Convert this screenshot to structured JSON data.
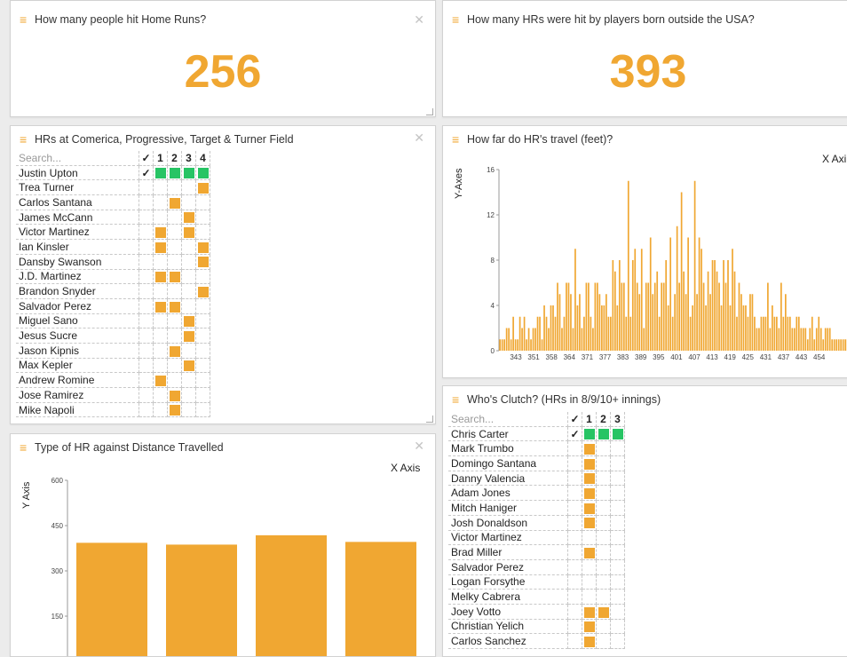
{
  "accent": "#f0a732",
  "green": "#27c464",
  "p1": {
    "title": "How many people hit Home Runs?",
    "value": "256"
  },
  "p2": {
    "title": "How many HRs were hit by players born outside the USA?",
    "value": "393"
  },
  "p3": {
    "title": "HRs at Comerica, Progressive, Target & Turner Field",
    "search": "Search...",
    "cols": [
      "✓",
      "1",
      "2",
      "3",
      "4"
    ],
    "rows": [
      {
        "name": "Justin Upton",
        "check": true,
        "cells": [
          "g",
          "g",
          "g",
          "g"
        ]
      },
      {
        "name": "Trea Turner",
        "check": false,
        "cells": [
          "",
          "",
          "",
          "o"
        ]
      },
      {
        "name": "Carlos Santana",
        "check": false,
        "cells": [
          "",
          "o",
          "",
          ""
        ]
      },
      {
        "name": "James McCann",
        "check": false,
        "cells": [
          "",
          "",
          "o",
          ""
        ]
      },
      {
        "name": "Victor Martinez",
        "check": false,
        "cells": [
          "o",
          "",
          "o",
          ""
        ]
      },
      {
        "name": "Ian Kinsler",
        "check": false,
        "cells": [
          "o",
          "",
          "",
          "o"
        ]
      },
      {
        "name": "Dansby Swanson",
        "check": false,
        "cells": [
          "",
          "",
          "",
          "o"
        ]
      },
      {
        "name": "J.D. Martinez",
        "check": false,
        "cells": [
          "o",
          "o",
          "",
          ""
        ]
      },
      {
        "name": "Brandon Snyder",
        "check": false,
        "cells": [
          "",
          "",
          "",
          "o"
        ]
      },
      {
        "name": "Salvador Perez",
        "check": false,
        "cells": [
          "o",
          "o",
          "",
          ""
        ]
      },
      {
        "name": "Miguel Sano",
        "check": false,
        "cells": [
          "",
          "",
          "o",
          ""
        ]
      },
      {
        "name": "Jesus Sucre",
        "check": false,
        "cells": [
          "",
          "",
          "o",
          ""
        ]
      },
      {
        "name": "Jason Kipnis",
        "check": false,
        "cells": [
          "",
          "o",
          "",
          ""
        ]
      },
      {
        "name": "Max Kepler",
        "check": false,
        "cells": [
          "",
          "",
          "o",
          ""
        ]
      },
      {
        "name": "Andrew Romine",
        "check": false,
        "cells": [
          "o",
          "",
          "",
          ""
        ]
      },
      {
        "name": "Jose Ramirez",
        "check": false,
        "cells": [
          "",
          "o",
          "",
          ""
        ]
      },
      {
        "name": "Mike Napoli",
        "check": false,
        "cells": [
          "",
          "o",
          "",
          ""
        ]
      }
    ]
  },
  "p4": {
    "title": "How far do HR's travel (feet)?",
    "xlabel": "X Axi",
    "ylabel": "Y-Axes",
    "chart_data": {
      "type": "bar",
      "ylim": [
        0,
        16
      ],
      "yticks": [
        0,
        4,
        8,
        12,
        16
      ],
      "xticks": [
        "343",
        "351",
        "358",
        "364",
        "371",
        "377",
        "383",
        "389",
        "395",
        "401",
        "407",
        "413",
        "419",
        "425",
        "431",
        "437",
        "443",
        "454"
      ],
      "values": [
        1,
        1,
        1,
        2,
        2,
        1,
        3,
        1,
        1,
        3,
        2,
        3,
        1,
        2,
        1,
        2,
        2,
        3,
        3,
        1,
        4,
        3,
        2,
        4,
        4,
        3,
        6,
        5,
        2,
        3,
        6,
        6,
        5,
        2,
        9,
        4,
        5,
        2,
        3,
        6,
        6,
        3,
        2,
        6,
        6,
        5,
        4,
        4,
        5,
        3,
        3,
        8,
        7,
        4,
        8,
        6,
        6,
        3,
        15,
        3,
        8,
        9,
        6,
        5,
        9,
        2,
        6,
        6,
        10,
        5,
        6,
        7,
        3,
        6,
        6,
        8,
        4,
        10,
        3,
        5,
        11,
        6,
        14,
        7,
        5,
        10,
        3,
        4,
        15,
        5,
        10,
        9,
        6,
        4,
        7,
        5,
        8,
        8,
        7,
        6,
        4,
        8,
        6,
        8,
        4,
        9,
        7,
        3,
        6,
        5,
        4,
        4,
        3,
        5,
        5,
        3,
        2,
        2,
        3,
        3,
        3,
        6,
        2,
        4,
        3,
        3,
        2,
        6,
        3,
        5,
        3,
        3,
        2,
        2,
        3,
        3,
        2,
        2,
        2,
        1,
        2,
        3,
        1,
        2,
        3,
        2,
        1,
        2,
        2,
        2,
        1,
        1,
        1,
        1,
        1,
        1,
        1,
        1,
        1,
        1
      ]
    }
  },
  "p5": {
    "title": "Type of HR against Distance Travelled",
    "xlabel": "X Axis",
    "ylabel": "Y Axis",
    "chart_data": {
      "type": "bar",
      "ylim": [
        0,
        600
      ],
      "yticks": [
        150,
        300,
        450,
        600
      ],
      "values": [
        393,
        387,
        418,
        396
      ]
    }
  },
  "p6": {
    "title": "Who's Clutch? (HRs in 8/9/10+ innings)",
    "search": "Search...",
    "cols": [
      "✓",
      "1",
      "2",
      "3"
    ],
    "rows": [
      {
        "name": "Chris Carter",
        "check": true,
        "cells": [
          "g",
          "g",
          "g"
        ]
      },
      {
        "name": "Mark Trumbo",
        "check": false,
        "cells": [
          "o",
          "",
          ""
        ]
      },
      {
        "name": "Domingo Santana",
        "check": false,
        "cells": [
          "o",
          "",
          ""
        ]
      },
      {
        "name": "Danny Valencia",
        "check": false,
        "cells": [
          "o",
          "",
          ""
        ]
      },
      {
        "name": "Adam Jones",
        "check": false,
        "cells": [
          "o",
          "",
          ""
        ]
      },
      {
        "name": "Mitch Haniger",
        "check": false,
        "cells": [
          "o",
          "",
          ""
        ]
      },
      {
        "name": "Josh Donaldson",
        "check": false,
        "cells": [
          "o",
          "",
          ""
        ]
      },
      {
        "name": "Victor Martinez",
        "check": false,
        "cells": [
          "",
          "",
          ""
        ]
      },
      {
        "name": "Brad Miller",
        "check": false,
        "cells": [
          "o",
          "",
          ""
        ]
      },
      {
        "name": "Salvador Perez",
        "check": false,
        "cells": [
          "",
          "",
          ""
        ]
      },
      {
        "name": "Logan Forsythe",
        "check": false,
        "cells": [
          "",
          "",
          ""
        ]
      },
      {
        "name": "Melky Cabrera",
        "check": false,
        "cells": [
          "",
          "",
          ""
        ]
      },
      {
        "name": "Joey Votto",
        "check": false,
        "cells": [
          "o",
          "o",
          ""
        ]
      },
      {
        "name": "Christian Yelich",
        "check": false,
        "cells": [
          "o",
          "",
          ""
        ]
      },
      {
        "name": "Carlos Sanchez",
        "check": false,
        "cells": [
          "o",
          "",
          ""
        ]
      }
    ]
  }
}
